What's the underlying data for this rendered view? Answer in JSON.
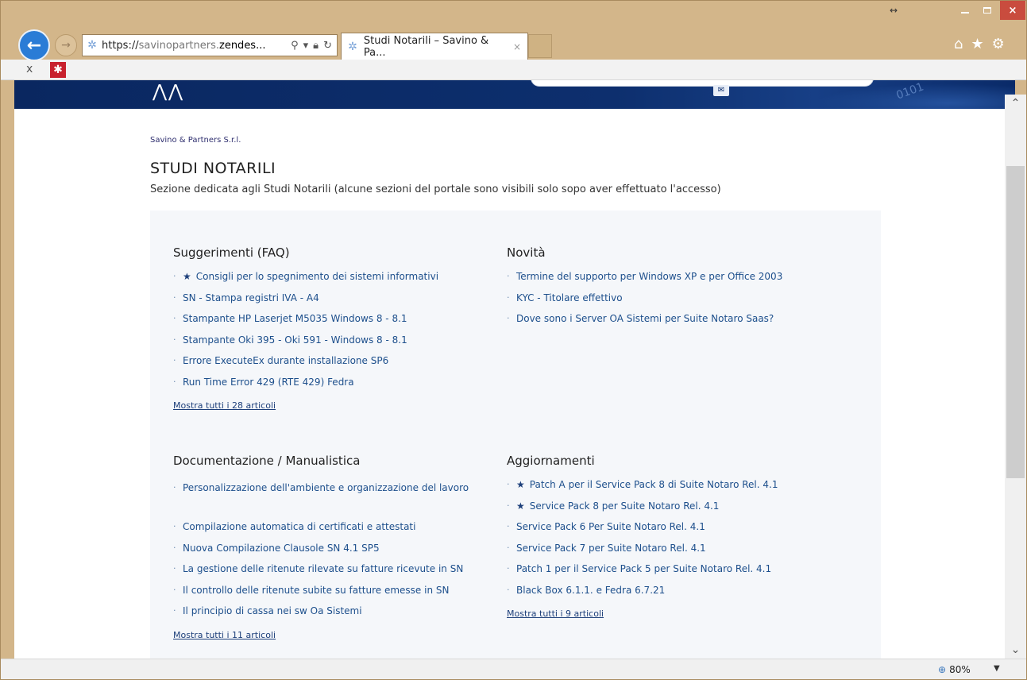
{
  "browser": {
    "address": {
      "scheme": "https://",
      "host_dim": "savinopartners.",
      "host": "zendes...",
      "search_icon": "search-icon",
      "lock_icon": "lock-icon",
      "refresh_icon": "refresh-icon"
    },
    "tab": {
      "title": "Studi Notarili – Savino & Pa...",
      "close_label": "×"
    },
    "command_bar": {
      "close_label": "x"
    },
    "window_controls": {
      "resize": "↔",
      "close": "×"
    },
    "status": {
      "zoom": "80%"
    }
  },
  "page": {
    "breadcrumb": "Savino & Partners S.r.l.",
    "title": "STUDI NOTARILI",
    "description": "Sezione dedicata agli Studi Notarili (alcune sezioni del portale sono visibili solo sopo aver effettuato l'accesso)"
  },
  "sections": {
    "faq": {
      "title": "Suggerimenti (FAQ)",
      "items": [
        "Consigli per lo spegnimento dei sistemi informativi",
        "SN - Stampa registri IVA - A4",
        "Stampante HP Laserjet M5035 Windows 8 - 8.1",
        "Stampante Oki 395 - Oki 591 - Windows 8 - 8.1",
        "Errore ExecuteEx durante installazione SP6",
        "Run Time Error 429 (RTE 429) Fedra"
      ],
      "more": "Mostra tutti i 28 articoli"
    },
    "news": {
      "title": "Novità",
      "items": [
        "Termine del supporto per Windows XP e per Office 2003",
        "KYC - Titolare effettivo",
        "Dove sono i Server OA Sistemi per Suite Notaro Saas?"
      ]
    },
    "docs": {
      "title": "Documentazione / Manualistica",
      "items": [
        "Personalizzazione dell'ambiente e organizzazione del lavoro",
        "Compilazione automatica di certificati e attestati",
        "Nuova Compilazione Clausole SN 4.1 SP5",
        "La gestione delle ritenute rilevate su fatture ricevute in SN",
        "Il controllo delle ritenute subite su fatture emesse in SN",
        "Il principio di cassa nei sw Oa Sistemi"
      ],
      "more": "Mostra tutti i 11 articoli"
    },
    "updates": {
      "title": "Aggiornamenti",
      "items": [
        "Patch A per il Service Pack 8 di Suite Notaro Rel. 4.1",
        "Service Pack 8 per Suite Notaro Rel. 4.1",
        "Service Pack 6 Per Suite Notaro Rel. 4.1",
        "Service Pack 7 per Suite Notaro Rel. 4.1",
        "Patch 1 per il Service Pack 5 per Suite Notaro Rel. 4.1",
        "Black Box 6.1.1. e Fedra 6.7.21"
      ],
      "more": "Mostra tutti i 9 articoli"
    }
  }
}
